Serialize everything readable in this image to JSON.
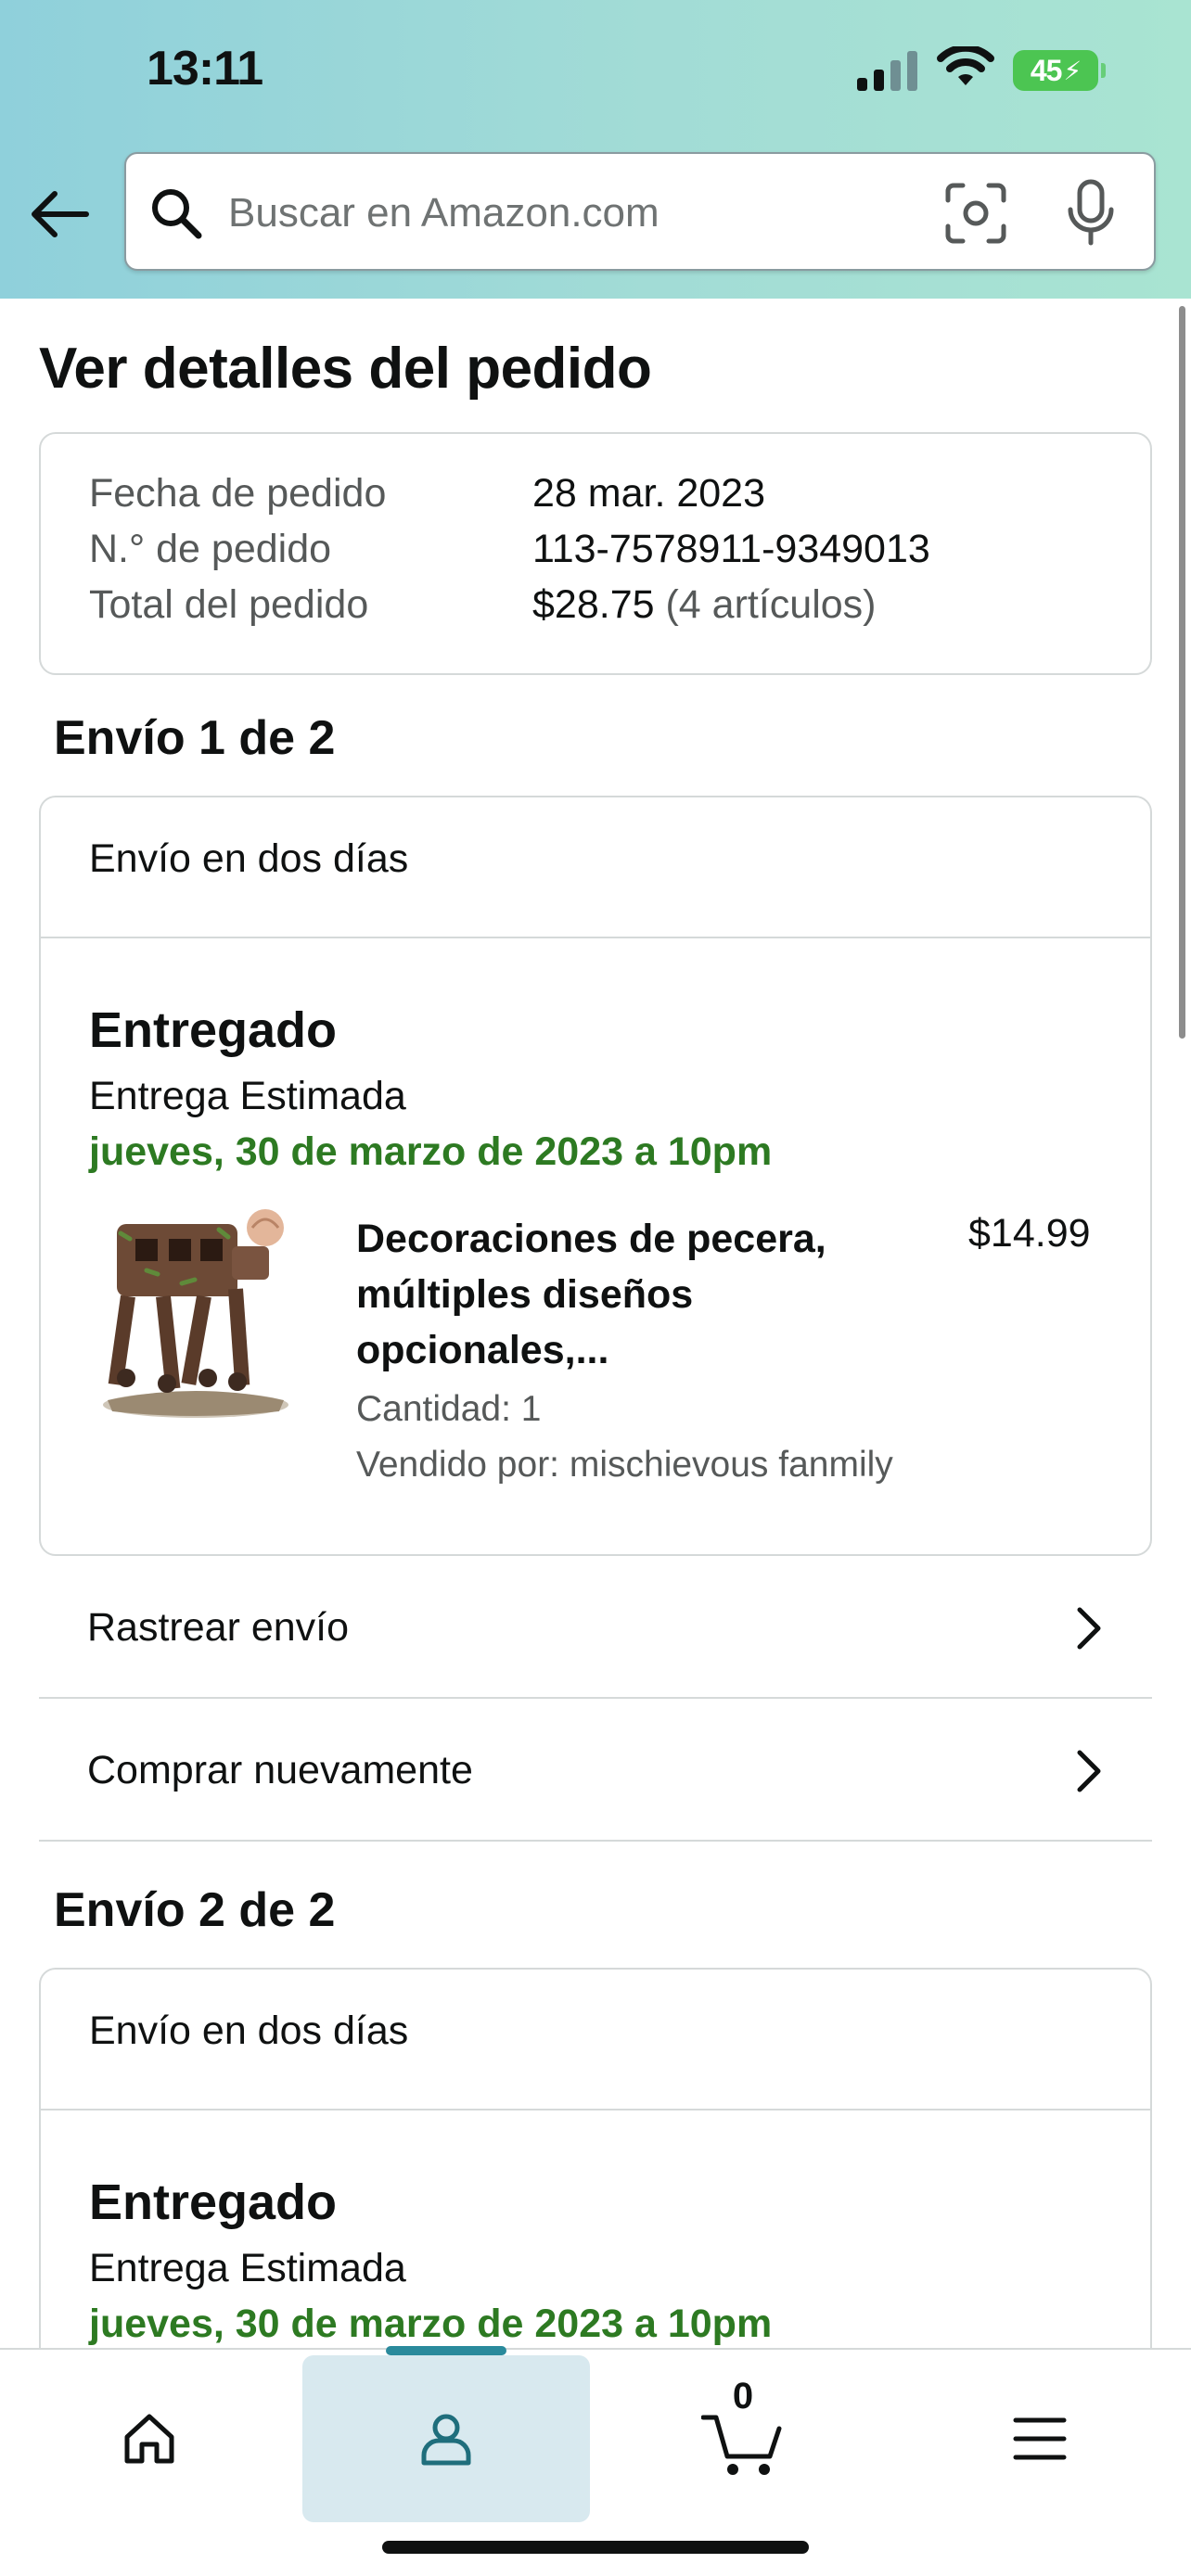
{
  "status_bar": {
    "time": "13:11",
    "battery": "45"
  },
  "search": {
    "placeholder": "Buscar en Amazon.com"
  },
  "page": {
    "title": "Ver detalles del pedido"
  },
  "order_summary": {
    "date_label": "Fecha de pedido",
    "date_value": "28 mar. 2023",
    "number_label": "N.° de pedido",
    "number_value": "113-7578911-9349013",
    "total_label": "Total del pedido",
    "total_value": "$28.75",
    "total_items": "(4 artículos)"
  },
  "shipments": [
    {
      "title": "Envío 1 de 2",
      "shipping_method": "Envío en dos días",
      "status": "Entregado",
      "estimate_label": "Entrega Estimada",
      "estimate_date": "jueves, 30 de marzo de 2023 a 10pm",
      "item": {
        "name": "Decoraciones de pecera, múltiples diseños opcionales,...",
        "price": "$14.99",
        "quantity": "Cantidad: 1",
        "seller": "Vendido por: mischievous fanmily"
      },
      "actions": [
        "Rastrear envío",
        "Comprar nuevamente"
      ]
    },
    {
      "title": "Envío 2 de 2",
      "shipping_method": "Envío en dos días",
      "status": "Entregado",
      "estimate_label": "Entrega Estimada",
      "estimate_date": "jueves, 30 de marzo de 2023 a 10pm"
    }
  ],
  "bottom_nav": {
    "cart_count": "0",
    "items": [
      "home-icon",
      "account-icon",
      "cart-icon",
      "menu-icon"
    ]
  },
  "colors": {
    "accent_green": "#2d7a22",
    "nav_active": "#d8e9ef",
    "nav_indicator": "#2a8a9c",
    "battery": "#4cc552"
  }
}
